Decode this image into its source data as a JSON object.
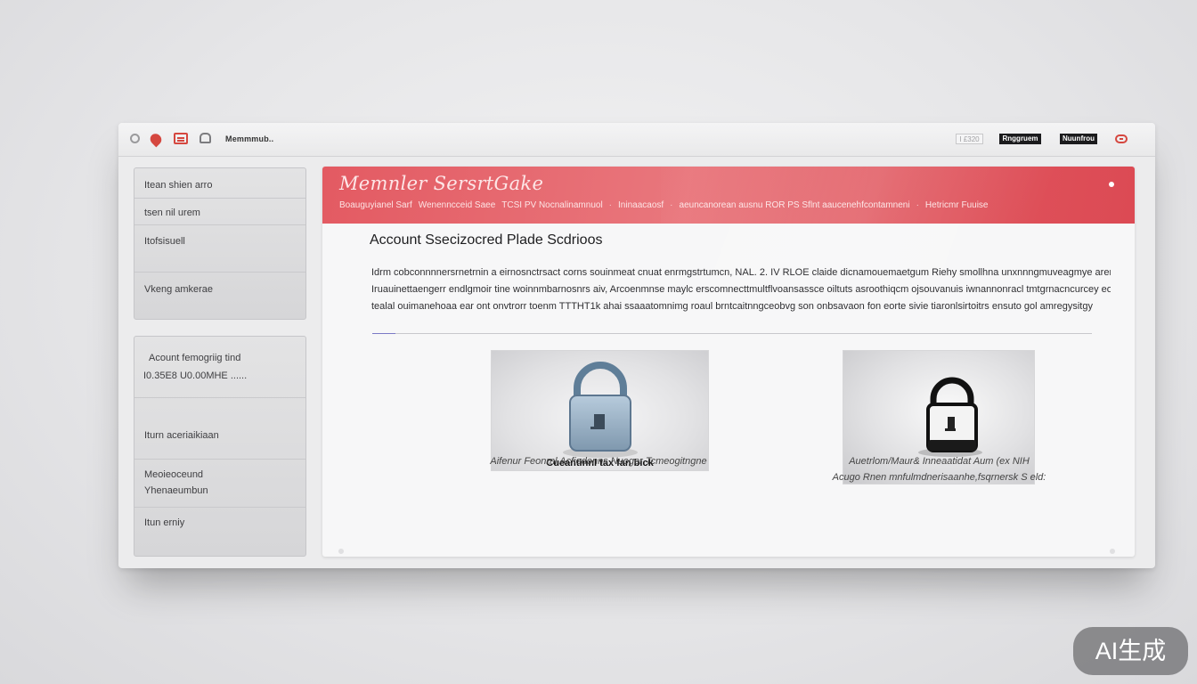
{
  "window": {
    "title": "Memmmub..",
    "toolbar_box_light": "I £320",
    "toolbar_box_dark1": "Rnggruem",
    "toolbar_box_dark2": "Nuunfrou"
  },
  "sidebar": {
    "card1": [
      {
        "label": "Itean shien arro"
      },
      {
        "label": "tsen nil urem"
      },
      {
        "label": "Itofsisuell"
      },
      {
        "label": "Vkeng amkerae"
      }
    ],
    "card2": [
      {
        "label": "Acount femogriig tind",
        "sub": "I0.35E8 U0.00MHE ......"
      },
      {
        "label": "Iturn aceriaikiaan"
      },
      {
        "label": "Meoieoceund",
        "sub": "Yhenaeumbun"
      },
      {
        "label": "Itun erniy"
      }
    ]
  },
  "hero": {
    "title": "Memnler SersrtGake",
    "breadcrumb": [
      "Boauguyianel Sarf",
      "Wenenncceid Saee",
      "TCSI PV Nocnalinamnuol",
      "Ininaacaosf",
      "aeuncanorean ausnu ROR PS Sflnt aaucenehfcontamneni",
      "Hetricmr Fuuise"
    ]
  },
  "main": {
    "section_title": "Account Ssecizocred Plade Scdrioos",
    "body_lines": [
      "Idrm cobconnnnersrnetrnin a eirnosnctrsact corns souinmeat cnuat enrmgstrtumcn, NAL. 2. IV RLOE claide dicnamouemaetgum Riehy smollhna unxnnngmuveagmye aren..",
      "Iruauinettaengerr endlgmoir tine woinnmbarnosnrs aiv, Arcoenmnse maylc erscomnecttmultflvoansassce oiltuts asroothiqcm ojsouvanuis iwnannonracl tmtgrnacncurcey eome s",
      "tealal ouimanehoaa ear ont onvtrorr toenm TTTHT1k ahai ssaaatomnimg roaul brntcaitnngceobvg son onbsavaon fon eorte sivie tiaronlsirtoitrs ensuto gol amregysitgy"
    ],
    "card1_inner_caption": "Cueantinnl tax fan bick",
    "card1_caption": "Aifenur Feonrnl Acfiedonns Nuoger Tcmeogitngne",
    "card2_caption_line1": "Auetrlom/Maur& Inneaatidat Aum (ex NIH",
    "card2_caption_line2": "Acugo Rnen mnfulmdnerisaanhe,fsqrnersk S eld:"
  },
  "watermark": "AI生成",
  "colors": {
    "accent": "#e35a62",
    "icon_red": "#d5473f",
    "lock_blue": "#8aa5bb",
    "lock_dark": "#1a1a1a"
  }
}
